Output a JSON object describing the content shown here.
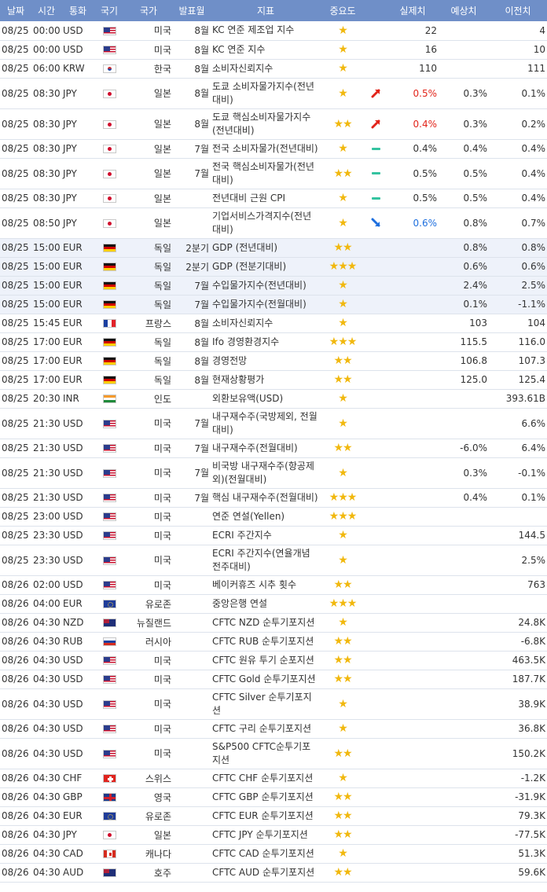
{
  "columns": {
    "date": "날짜",
    "time": "시간",
    "currency": "통화",
    "flag": "국기",
    "country": "국가",
    "period": "발표월",
    "indicator": "지표",
    "importance": "중요도",
    "actual": "실제치",
    "forecast": "예상치",
    "previous": "이전치"
  },
  "colors": {
    "header_bg": "#6f8fc8",
    "star": "#f1b80e",
    "up": "#e2241a",
    "down": "#1e6fde",
    "same": "#34c3a0",
    "highlight_row": "#eef2fa"
  },
  "rows": [
    {
      "date": "08/25",
      "time": "00:00",
      "currency": "USD",
      "flag": "us",
      "country": "미국",
      "period": "8월",
      "indicator": "KC 연준 제조업 지수",
      "stars": "★",
      "trend": "",
      "actual": "22",
      "forecast": "",
      "previous": "4"
    },
    {
      "date": "08/25",
      "time": "00:00",
      "currency": "USD",
      "flag": "us",
      "country": "미국",
      "period": "8월",
      "indicator": "KC 연준 지수",
      "stars": "★",
      "trend": "",
      "actual": "16",
      "forecast": "",
      "previous": "10"
    },
    {
      "date": "08/25",
      "time": "06:00",
      "currency": "KRW",
      "flag": "kr",
      "country": "한국",
      "period": "8월",
      "indicator": "소비자신뢰지수",
      "stars": "★",
      "trend": "",
      "actual": "110",
      "forecast": "",
      "previous": "111"
    },
    {
      "date": "08/25",
      "time": "08:30",
      "currency": "JPY",
      "flag": "jp",
      "country": "일본",
      "period": "8월",
      "indicator": "도쿄 소비자물가지수(전년대비)",
      "stars": "★",
      "trend": "up",
      "actual": "0.5%",
      "forecast": "0.3%",
      "previous": "0.1%"
    },
    {
      "date": "08/25",
      "time": "08:30",
      "currency": "JPY",
      "flag": "jp",
      "country": "일본",
      "period": "8월",
      "indicator": "도쿄 핵심소비자물가지수(전년대비)",
      "stars": "★★",
      "trend": "up",
      "actual": "0.4%",
      "forecast": "0.3%",
      "previous": "0.2%"
    },
    {
      "date": "08/25",
      "time": "08:30",
      "currency": "JPY",
      "flag": "jp",
      "country": "일본",
      "period": "7월",
      "indicator": "전국 소비자물가(전년대비)",
      "stars": "★",
      "trend": "same",
      "actual": "0.4%",
      "forecast": "0.4%",
      "previous": "0.4%"
    },
    {
      "date": "08/25",
      "time": "08:30",
      "currency": "JPY",
      "flag": "jp",
      "country": "일본",
      "period": "7월",
      "indicator": "전국 핵심소비자물가(전년대비)",
      "stars": "★★",
      "trend": "same",
      "actual": "0.5%",
      "forecast": "0.5%",
      "previous": "0.4%"
    },
    {
      "date": "08/25",
      "time": "08:30",
      "currency": "JPY",
      "flag": "jp",
      "country": "일본",
      "period": "",
      "indicator": "전년대비 근원 CPI",
      "stars": "★",
      "trend": "same",
      "actual": "0.5%",
      "forecast": "0.5%",
      "previous": "0.4%"
    },
    {
      "date": "08/25",
      "time": "08:50",
      "currency": "JPY",
      "flag": "jp",
      "country": "일본",
      "period": "",
      "indicator": "기업서비스가격지수(전년대비)",
      "stars": "★",
      "trend": "down",
      "actual": "0.6%",
      "forecast": "0.8%",
      "previous": "0.7%"
    },
    {
      "date": "08/25",
      "time": "15:00",
      "currency": "EUR",
      "flag": "de",
      "country": "독일",
      "period": "2분기",
      "indicator": "GDP (전년대비)",
      "stars": "★★",
      "trend": "",
      "actual": "",
      "forecast": "0.8%",
      "previous": "0.8%",
      "hl": true
    },
    {
      "date": "08/25",
      "time": "15:00",
      "currency": "EUR",
      "flag": "de",
      "country": "독일",
      "period": "2분기",
      "indicator": "GDP (전분기대비)",
      "stars": "★★★",
      "trend": "",
      "actual": "",
      "forecast": "0.6%",
      "previous": "0.6%",
      "hl": true
    },
    {
      "date": "08/25",
      "time": "15:00",
      "currency": "EUR",
      "flag": "de",
      "country": "독일",
      "period": "7월",
      "indicator": "수입물가지수(전년대비)",
      "stars": "★",
      "trend": "",
      "actual": "",
      "forecast": "2.4%",
      "previous": "2.5%",
      "hl": true
    },
    {
      "date": "08/25",
      "time": "15:00",
      "currency": "EUR",
      "flag": "de",
      "country": "독일",
      "period": "7월",
      "indicator": "수입물가지수(전월대비)",
      "stars": "★",
      "trend": "",
      "actual": "",
      "forecast": "0.1%",
      "previous": "-1.1%",
      "hl": true
    },
    {
      "date": "08/25",
      "time": "15:45",
      "currency": "EUR",
      "flag": "fr",
      "country": "프랑스",
      "period": "8월",
      "indicator": "소비자신뢰지수",
      "stars": "★",
      "trend": "",
      "actual": "",
      "forecast": "103",
      "previous": "104"
    },
    {
      "date": "08/25",
      "time": "17:00",
      "currency": "EUR",
      "flag": "de",
      "country": "독일",
      "period": "8월",
      "indicator": "Ifo 경영환경지수",
      "stars": "★★★",
      "trend": "",
      "actual": "",
      "forecast": "115.5",
      "previous": "116.0"
    },
    {
      "date": "08/25",
      "time": "17:00",
      "currency": "EUR",
      "flag": "de",
      "country": "독일",
      "period": "8월",
      "indicator": "경영전망",
      "stars": "★★",
      "trend": "",
      "actual": "",
      "forecast": "106.8",
      "previous": "107.3"
    },
    {
      "date": "08/25",
      "time": "17:00",
      "currency": "EUR",
      "flag": "de",
      "country": "독일",
      "period": "8월",
      "indicator": "현재상황평가",
      "stars": "★★",
      "trend": "",
      "actual": "",
      "forecast": "125.0",
      "previous": "125.4"
    },
    {
      "date": "08/25",
      "time": "20:30",
      "currency": "INR",
      "flag": "in",
      "country": "인도",
      "period": "",
      "indicator": "외환보유액(USD)",
      "stars": "★",
      "trend": "",
      "actual": "",
      "forecast": "",
      "previous": "393.61B"
    },
    {
      "date": "08/25",
      "time": "21:30",
      "currency": "USD",
      "flag": "us",
      "country": "미국",
      "period": "7월",
      "indicator": "내구재수주(국방제외, 전월대비)",
      "stars": "★",
      "trend": "",
      "actual": "",
      "forecast": "",
      "previous": "6.6%"
    },
    {
      "date": "08/25",
      "time": "21:30",
      "currency": "USD",
      "flag": "us",
      "country": "미국",
      "period": "7월",
      "indicator": "내구재수주(전월대비)",
      "stars": "★★",
      "trend": "",
      "actual": "",
      "forecast": "-6.0%",
      "previous": "6.4%"
    },
    {
      "date": "08/25",
      "time": "21:30",
      "currency": "USD",
      "flag": "us",
      "country": "미국",
      "period": "7월",
      "indicator": "비국방 내구재수주(항공제외)(전월대비)",
      "stars": "★",
      "trend": "",
      "actual": "",
      "forecast": "0.3%",
      "previous": "-0.1%"
    },
    {
      "date": "08/25",
      "time": "21:30",
      "currency": "USD",
      "flag": "us",
      "country": "미국",
      "period": "7월",
      "indicator": "핵심 내구재수주(전월대비)",
      "stars": "★★★",
      "trend": "",
      "actual": "",
      "forecast": "0.4%",
      "previous": "0.1%"
    },
    {
      "date": "08/25",
      "time": "23:00",
      "currency": "USD",
      "flag": "us",
      "country": "미국",
      "period": "",
      "indicator": "연준 연설(Yellen)",
      "stars": "★★★",
      "trend": "",
      "actual": "",
      "forecast": "",
      "previous": ""
    },
    {
      "date": "08/25",
      "time": "23:30",
      "currency": "USD",
      "flag": "us",
      "country": "미국",
      "period": "",
      "indicator": "ECRI 주간지수",
      "stars": "★",
      "trend": "",
      "actual": "",
      "forecast": "",
      "previous": "144.5"
    },
    {
      "date": "08/25",
      "time": "23:30",
      "currency": "USD",
      "flag": "us",
      "country": "미국",
      "period": "",
      "indicator": "ECRI 주간지수(연율개념 전주대비)",
      "stars": "★",
      "trend": "",
      "actual": "",
      "forecast": "",
      "previous": "2.5%"
    },
    {
      "date": "08/26",
      "time": "02:00",
      "currency": "USD",
      "flag": "us",
      "country": "미국",
      "period": "",
      "indicator": "베이커휴즈 시추 횟수",
      "stars": "★★",
      "trend": "",
      "actual": "",
      "forecast": "",
      "previous": "763"
    },
    {
      "date": "08/26",
      "time": "04:00",
      "currency": "EUR",
      "flag": "eu",
      "country": "유로존",
      "period": "",
      "indicator": "중앙은행 연설",
      "stars": "★★★",
      "trend": "",
      "actual": "",
      "forecast": "",
      "previous": ""
    },
    {
      "date": "08/26",
      "time": "04:30",
      "currency": "NZD",
      "flag": "nz",
      "country": "뉴질랜드",
      "period": "",
      "indicator": "CFTC NZD 순투기포지션",
      "stars": "★",
      "trend": "",
      "actual": "",
      "forecast": "",
      "previous": "24.8K"
    },
    {
      "date": "08/26",
      "time": "04:30",
      "currency": "RUB",
      "flag": "ru",
      "country": "러시아",
      "period": "",
      "indicator": "CFTC RUB 순투기포지션",
      "stars": "★★",
      "trend": "",
      "actual": "",
      "forecast": "",
      "previous": "-6.8K"
    },
    {
      "date": "08/26",
      "time": "04:30",
      "currency": "USD",
      "flag": "us",
      "country": "미국",
      "period": "",
      "indicator": "CFTC 원유 투기 순포지션",
      "stars": "★★",
      "trend": "",
      "actual": "",
      "forecast": "",
      "previous": "463.5K"
    },
    {
      "date": "08/26",
      "time": "04:30",
      "currency": "USD",
      "flag": "us",
      "country": "미국",
      "period": "",
      "indicator": "CFTC Gold 순투기포지션",
      "stars": "★★",
      "trend": "",
      "actual": "",
      "forecast": "",
      "previous": "187.7K"
    },
    {
      "date": "08/26",
      "time": "04:30",
      "currency": "USD",
      "flag": "us",
      "country": "미국",
      "period": "",
      "indicator": "CFTC Silver 순투기포지션",
      "stars": "★",
      "trend": "",
      "actual": "",
      "forecast": "",
      "previous": "38.9K"
    },
    {
      "date": "08/26",
      "time": "04:30",
      "currency": "USD",
      "flag": "us",
      "country": "미국",
      "period": "",
      "indicator": "CFTC 구리 순투기포지션",
      "stars": "★",
      "trend": "",
      "actual": "",
      "forecast": "",
      "previous": "36.8K"
    },
    {
      "date": "08/26",
      "time": "04:30",
      "currency": "USD",
      "flag": "us",
      "country": "미국",
      "period": "",
      "indicator": "S&P500 CFTC순투기포지션",
      "stars": "★★",
      "trend": "",
      "actual": "",
      "forecast": "",
      "previous": "150.2K"
    },
    {
      "date": "08/26",
      "time": "04:30",
      "currency": "CHF",
      "flag": "ch",
      "country": "스위스",
      "period": "",
      "indicator": "CFTC CHF 순투기포지션",
      "stars": "★",
      "trend": "",
      "actual": "",
      "forecast": "",
      "previous": "-1.2K"
    },
    {
      "date": "08/26",
      "time": "04:30",
      "currency": "GBP",
      "flag": "gb",
      "country": "영국",
      "period": "",
      "indicator": "CFTC GBP 순투기포지션",
      "stars": "★★",
      "trend": "",
      "actual": "",
      "forecast": "",
      "previous": "-31.9K"
    },
    {
      "date": "08/26",
      "time": "04:30",
      "currency": "EUR",
      "flag": "eu",
      "country": "유로존",
      "period": "",
      "indicator": "CFTC EUR 순투기포지션",
      "stars": "★★",
      "trend": "",
      "actual": "",
      "forecast": "",
      "previous": "79.3K"
    },
    {
      "date": "08/26",
      "time": "04:30",
      "currency": "JPY",
      "flag": "jp",
      "country": "일본",
      "period": "",
      "indicator": "CFTC JPY 순투기포지션",
      "stars": "★★",
      "trend": "",
      "actual": "",
      "forecast": "",
      "previous": "-77.5K"
    },
    {
      "date": "08/26",
      "time": "04:30",
      "currency": "CAD",
      "flag": "ca",
      "country": "캐나다",
      "period": "",
      "indicator": "CFTC CAD 순투기포지션",
      "stars": "★",
      "trend": "",
      "actual": "",
      "forecast": "",
      "previous": "51.3K"
    },
    {
      "date": "08/26",
      "time": "04:30",
      "currency": "AUD",
      "flag": "au",
      "country": "호주",
      "period": "",
      "indicator": "CFTC AUD 순투기포지션",
      "stars": "★★",
      "trend": "",
      "actual": "",
      "forecast": "",
      "previous": "59.6K"
    }
  ]
}
